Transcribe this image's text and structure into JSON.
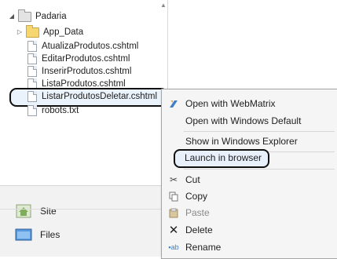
{
  "tree": {
    "root": "Padaria",
    "items": [
      {
        "label": "App_Data",
        "kind": "folder"
      },
      {
        "label": "AtualizaProdutos.cshtml",
        "kind": "file"
      },
      {
        "label": "EditarProdutos.cshtml",
        "kind": "file"
      },
      {
        "label": "InserirProdutos.cshtml",
        "kind": "file"
      },
      {
        "label": "ListaProdutos.cshtml",
        "kind": "file"
      },
      {
        "label": "ListarProdutosDeletar.cshtml",
        "kind": "file",
        "selected": true
      },
      {
        "label": "robots.txt",
        "kind": "file"
      }
    ]
  },
  "nav": {
    "site": "Site",
    "files": "Files"
  },
  "context_menu": {
    "items": [
      {
        "label": "Open with WebMatrix",
        "icon": "webmatrix-icon"
      },
      {
        "label": "Open with Windows Default",
        "icon": ""
      },
      {
        "label": "Show in Windows Explorer",
        "icon": ""
      },
      {
        "label": "Launch in browser",
        "icon": "",
        "highlighted": true
      },
      {
        "label": "Cut",
        "icon": "scissors-icon"
      },
      {
        "label": "Copy",
        "icon": "copy-icon"
      },
      {
        "label": "Paste",
        "icon": "paste-icon",
        "disabled": true
      },
      {
        "label": "Delete",
        "icon": "delete-icon"
      },
      {
        "label": "Rename",
        "icon": "rename-icon"
      }
    ]
  },
  "colors": {
    "folder": "#f6d66e",
    "selection": "#eaf2fb",
    "menu_bg": "#f5f5f5",
    "delete_x": "#222222",
    "site_icon": "#7fae5a",
    "files_icon": "#3d7fc7"
  }
}
